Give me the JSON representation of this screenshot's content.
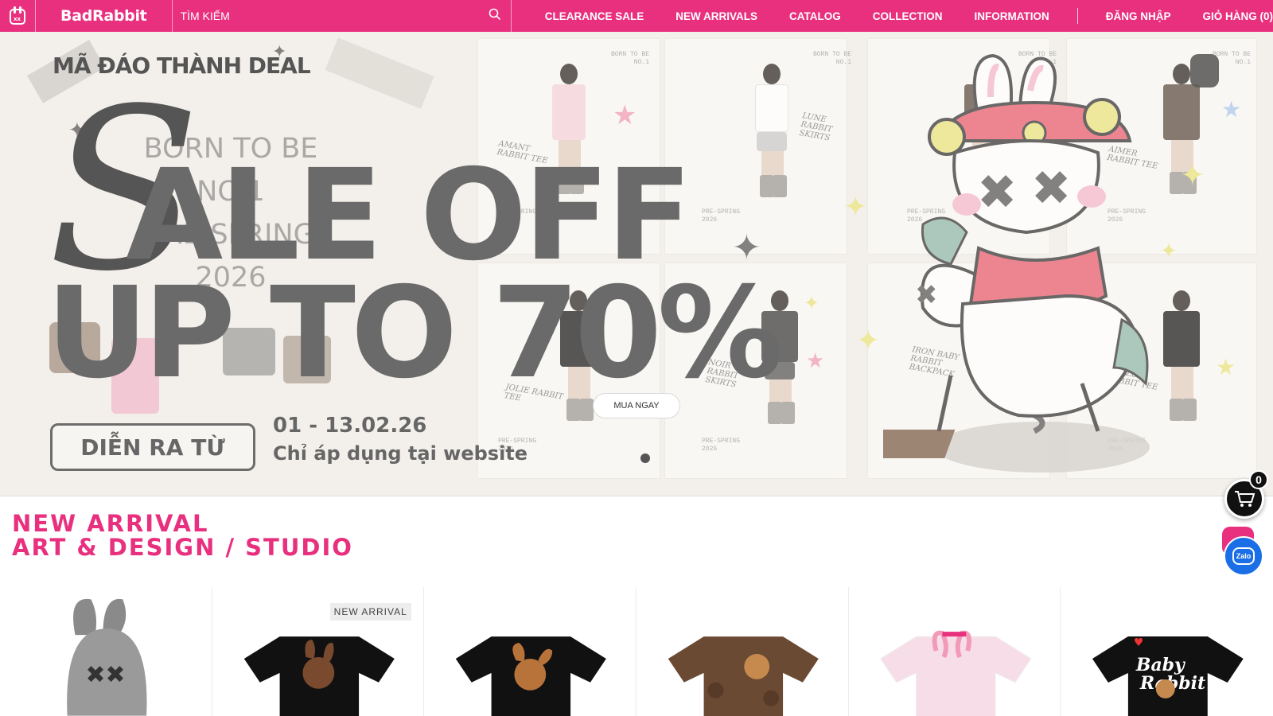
{
  "header": {
    "brand": "BadRabbit",
    "search_placeholder": "TÌM KIẾM",
    "nav": [
      "CLEARANCE SALE",
      "NEW ARRIVALS",
      "CATALOG",
      "COLLECTION",
      "INFORMATION"
    ],
    "login": "ĐĂNG NHẬP",
    "cart": "GIỎ HÀNG (0)",
    "brand_color": "#e8307f"
  },
  "hero": {
    "deal_title": "MÃ ĐÁO THÀNH DEAL",
    "born_line1": "BORN TO BE",
    "born_line2": "NO.1",
    "born_line3": "PRE-SPRING 2026",
    "sale_line1": "ALE OFF",
    "sale_script_letter": "S",
    "sale_line2": "UP TO 70%",
    "date_label": "DIỄN RA TỪ",
    "date_range": "01 - 13.02.26",
    "date_note": "Chỉ áp dụng tại website",
    "cta": "MUA NGAY",
    "product_notes": [
      "AMANT RABBIT TEE",
      "LUNE RABBIT SKIRTS",
      "JOLIE RABBIT TEE",
      "NOIR RABBIT SKIRTS",
      "IRON BABY RABBIT BACKPACK",
      "AIMER RABBIT TEE",
      "PUZZLE RABBIT TEE"
    ],
    "born_tag": "BORN TO BE NO.1",
    "season_tag": "PRE-SPRING 2026"
  },
  "floating": {
    "cart_count": "0",
    "zalo_label": "Zalo"
  },
  "section": {
    "title_line1": "NEW ARRIVAL",
    "title_line2": "ART & DESIGN / STUDIO",
    "badge": "NEW ARRIVAL"
  },
  "icons": [
    "rabbit-logo-icon",
    "search-icon",
    "cart-icon",
    "zalo-icon"
  ]
}
